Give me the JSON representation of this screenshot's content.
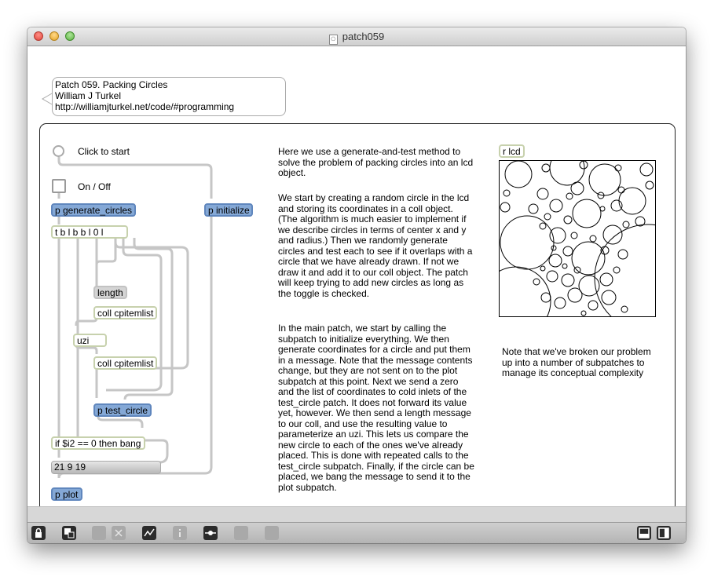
{
  "window": {
    "title": "patch059"
  },
  "header_comment": {
    "line1": "Patch 059. Packing Circles",
    "line2": "William J Turkel",
    "line3": "http://williamjturkel.net/code/#programming"
  },
  "controls": {
    "start_label": "Click to start",
    "toggle_label": "On / Off"
  },
  "objects": {
    "generate": "p generate_circles",
    "initialize": "p initialize",
    "trigger": "t b l b b l 0 l",
    "length": "length",
    "coll1": "coll cpitemlist",
    "uzi": "uzi",
    "coll2": "coll cpitemlist",
    "test": "p test_circle",
    "ifobj": "if $i2 == 0 then bang",
    "numlist": "21 9 19",
    "plot": "p plot",
    "rlcd": "r lcd"
  },
  "description": {
    "para1": "Here we use a generate-and-test method to solve the problem of packing circles into an lcd object.",
    "para2": "We start by creating a random circle in the lcd and storing its coordinates in a coll object. (The algorithm is much easier to implement if we describe circles in terms of center x and y and radius.) Then we randomly generate circles and test each to see if it overlaps with a circle that we have already drawn. If not we draw it and add it to our coll object. The patch will keep trying to add new circles as long as the toggle is checked.",
    "para3": "In the main patch, we start by calling the subpatch to initialize everything. We then generate coordinates for a circle and put them in a message. Note that the message contents change, but they are not sent on to the plot subpatch at this point. Next we send a zero and the list of coordinates to cold inlets of the test_circle patch. It does not forward its value yet, however. We then send a length message to our coll, and use the resulting value to parameterize an uzi. This lets us compare the new circle to each of the ones we've already placed. This is done with repeated calls to the test_circle subpatch. Finally, if the circle can be placed, we bang the message to send it to the plot subpatch.",
    "side_note": "Note that we've broken our problem up into a number of subpatches to manage its conceptual complexity"
  },
  "toolbar": {
    "icons": [
      "lock-icon",
      "presentation-icon",
      "clipboard-icon",
      "delete-icon",
      "debug-icon",
      "info-icon",
      "connect-icon",
      "grid-icon",
      "settings-icon",
      "split-left-icon",
      "split-right-icon"
    ]
  }
}
